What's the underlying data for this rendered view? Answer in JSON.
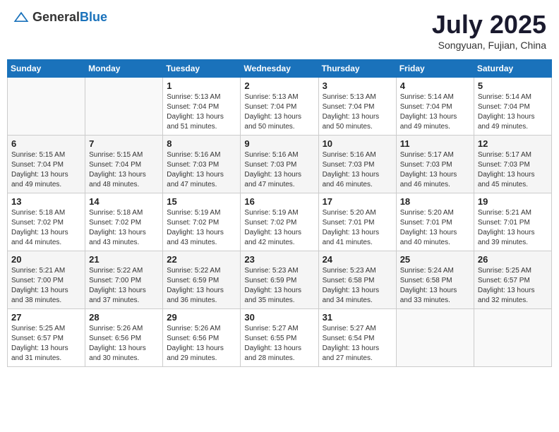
{
  "header": {
    "logo_general": "General",
    "logo_blue": "Blue",
    "month_year": "July 2025",
    "location": "Songyuan, Fujian, China"
  },
  "days_of_week": [
    "Sunday",
    "Monday",
    "Tuesday",
    "Wednesday",
    "Thursday",
    "Friday",
    "Saturday"
  ],
  "weeks": [
    [
      {
        "day": "",
        "sunrise": "",
        "sunset": "",
        "daylight": ""
      },
      {
        "day": "",
        "sunrise": "",
        "sunset": "",
        "daylight": ""
      },
      {
        "day": "1",
        "sunrise": "Sunrise: 5:13 AM",
        "sunset": "Sunset: 7:04 PM",
        "daylight": "Daylight: 13 hours and 51 minutes."
      },
      {
        "day": "2",
        "sunrise": "Sunrise: 5:13 AM",
        "sunset": "Sunset: 7:04 PM",
        "daylight": "Daylight: 13 hours and 50 minutes."
      },
      {
        "day": "3",
        "sunrise": "Sunrise: 5:13 AM",
        "sunset": "Sunset: 7:04 PM",
        "daylight": "Daylight: 13 hours and 50 minutes."
      },
      {
        "day": "4",
        "sunrise": "Sunrise: 5:14 AM",
        "sunset": "Sunset: 7:04 PM",
        "daylight": "Daylight: 13 hours and 49 minutes."
      },
      {
        "day": "5",
        "sunrise": "Sunrise: 5:14 AM",
        "sunset": "Sunset: 7:04 PM",
        "daylight": "Daylight: 13 hours and 49 minutes."
      }
    ],
    [
      {
        "day": "6",
        "sunrise": "Sunrise: 5:15 AM",
        "sunset": "Sunset: 7:04 PM",
        "daylight": "Daylight: 13 hours and 49 minutes."
      },
      {
        "day": "7",
        "sunrise": "Sunrise: 5:15 AM",
        "sunset": "Sunset: 7:04 PM",
        "daylight": "Daylight: 13 hours and 48 minutes."
      },
      {
        "day": "8",
        "sunrise": "Sunrise: 5:16 AM",
        "sunset": "Sunset: 7:03 PM",
        "daylight": "Daylight: 13 hours and 47 minutes."
      },
      {
        "day": "9",
        "sunrise": "Sunrise: 5:16 AM",
        "sunset": "Sunset: 7:03 PM",
        "daylight": "Daylight: 13 hours and 47 minutes."
      },
      {
        "day": "10",
        "sunrise": "Sunrise: 5:16 AM",
        "sunset": "Sunset: 7:03 PM",
        "daylight": "Daylight: 13 hours and 46 minutes."
      },
      {
        "day": "11",
        "sunrise": "Sunrise: 5:17 AM",
        "sunset": "Sunset: 7:03 PM",
        "daylight": "Daylight: 13 hours and 46 minutes."
      },
      {
        "day": "12",
        "sunrise": "Sunrise: 5:17 AM",
        "sunset": "Sunset: 7:03 PM",
        "daylight": "Daylight: 13 hours and 45 minutes."
      }
    ],
    [
      {
        "day": "13",
        "sunrise": "Sunrise: 5:18 AM",
        "sunset": "Sunset: 7:02 PM",
        "daylight": "Daylight: 13 hours and 44 minutes."
      },
      {
        "day": "14",
        "sunrise": "Sunrise: 5:18 AM",
        "sunset": "Sunset: 7:02 PM",
        "daylight": "Daylight: 13 hours and 43 minutes."
      },
      {
        "day": "15",
        "sunrise": "Sunrise: 5:19 AM",
        "sunset": "Sunset: 7:02 PM",
        "daylight": "Daylight: 13 hours and 43 minutes."
      },
      {
        "day": "16",
        "sunrise": "Sunrise: 5:19 AM",
        "sunset": "Sunset: 7:02 PM",
        "daylight": "Daylight: 13 hours and 42 minutes."
      },
      {
        "day": "17",
        "sunrise": "Sunrise: 5:20 AM",
        "sunset": "Sunset: 7:01 PM",
        "daylight": "Daylight: 13 hours and 41 minutes."
      },
      {
        "day": "18",
        "sunrise": "Sunrise: 5:20 AM",
        "sunset": "Sunset: 7:01 PM",
        "daylight": "Daylight: 13 hours and 40 minutes."
      },
      {
        "day": "19",
        "sunrise": "Sunrise: 5:21 AM",
        "sunset": "Sunset: 7:01 PM",
        "daylight": "Daylight: 13 hours and 39 minutes."
      }
    ],
    [
      {
        "day": "20",
        "sunrise": "Sunrise: 5:21 AM",
        "sunset": "Sunset: 7:00 PM",
        "daylight": "Daylight: 13 hours and 38 minutes."
      },
      {
        "day": "21",
        "sunrise": "Sunrise: 5:22 AM",
        "sunset": "Sunset: 7:00 PM",
        "daylight": "Daylight: 13 hours and 37 minutes."
      },
      {
        "day": "22",
        "sunrise": "Sunrise: 5:22 AM",
        "sunset": "Sunset: 6:59 PM",
        "daylight": "Daylight: 13 hours and 36 minutes."
      },
      {
        "day": "23",
        "sunrise": "Sunrise: 5:23 AM",
        "sunset": "Sunset: 6:59 PM",
        "daylight": "Daylight: 13 hours and 35 minutes."
      },
      {
        "day": "24",
        "sunrise": "Sunrise: 5:23 AM",
        "sunset": "Sunset: 6:58 PM",
        "daylight": "Daylight: 13 hours and 34 minutes."
      },
      {
        "day": "25",
        "sunrise": "Sunrise: 5:24 AM",
        "sunset": "Sunset: 6:58 PM",
        "daylight": "Daylight: 13 hours and 33 minutes."
      },
      {
        "day": "26",
        "sunrise": "Sunrise: 5:25 AM",
        "sunset": "Sunset: 6:57 PM",
        "daylight": "Daylight: 13 hours and 32 minutes."
      }
    ],
    [
      {
        "day": "27",
        "sunrise": "Sunrise: 5:25 AM",
        "sunset": "Sunset: 6:57 PM",
        "daylight": "Daylight: 13 hours and 31 minutes."
      },
      {
        "day": "28",
        "sunrise": "Sunrise: 5:26 AM",
        "sunset": "Sunset: 6:56 PM",
        "daylight": "Daylight: 13 hours and 30 minutes."
      },
      {
        "day": "29",
        "sunrise": "Sunrise: 5:26 AM",
        "sunset": "Sunset: 6:56 PM",
        "daylight": "Daylight: 13 hours and 29 minutes."
      },
      {
        "day": "30",
        "sunrise": "Sunrise: 5:27 AM",
        "sunset": "Sunset: 6:55 PM",
        "daylight": "Daylight: 13 hours and 28 minutes."
      },
      {
        "day": "31",
        "sunrise": "Sunrise: 5:27 AM",
        "sunset": "Sunset: 6:54 PM",
        "daylight": "Daylight: 13 hours and 27 minutes."
      },
      {
        "day": "",
        "sunrise": "",
        "sunset": "",
        "daylight": ""
      },
      {
        "day": "",
        "sunrise": "",
        "sunset": "",
        "daylight": ""
      }
    ]
  ]
}
